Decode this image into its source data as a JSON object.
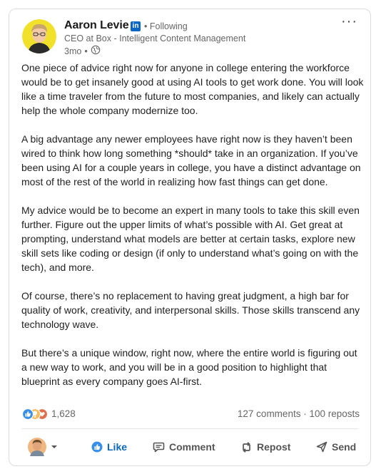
{
  "post": {
    "author": {
      "name": "Aaron Levie",
      "follow_status": "Following",
      "headline": "CEO at Box - Intelligent Content Management",
      "time": "3mo"
    },
    "paragraphs": [
      "One piece of advice right now for anyone in college entering the workforce would be to get insanely good at using AI tools to get work done. You will look like a time traveler from the future to most companies, and likely can actually help the whole company modernize too.",
      "A big advantage any newer employees have right now is they haven’t been wired to think how long something *should* take in an organization. If you’ve been using AI for a couple years in college, you have a distinct advantage on most of the rest of the world in realizing how fast things can get done.",
      "My advice would be to become an expert in many tools to take this skill even further. Figure out the upper limits of what’s possible with AI. Get great at prompting, understand what models are better at certain tasks, explore new skill sets like coding or design (if only to understand what’s going on with the tech), and more.",
      "Of course, there’s no replacement to having great judgment, a high bar for quality of work, creativity, and interpersonal skills. Those skills transcend any technology wave.",
      "But there’s a unique window, right now, where the entire world is figuring out a new way to work, and you will be in a good position to highlight that blueprint as every company goes AI-first."
    ],
    "reactions": "1,628",
    "comments_reposts": "127 comments · 100 reposts"
  },
  "actions": {
    "like": "Like",
    "comment": "Comment",
    "repost": "Repost",
    "send": "Send"
  },
  "colors": {
    "like_blue": "#378fe9",
    "celebrate_green": "#44712e",
    "love_red": "#df704d",
    "linkedin_blue": "#0a66c2"
  },
  "icons": [
    "more-icon",
    "linkedin-icon",
    "globe-icon",
    "like-reaction-icon",
    "insightful-reaction-icon",
    "love-reaction-icon",
    "caret-down-icon",
    "like-icon",
    "comment-icon",
    "repost-icon",
    "send-icon"
  ]
}
